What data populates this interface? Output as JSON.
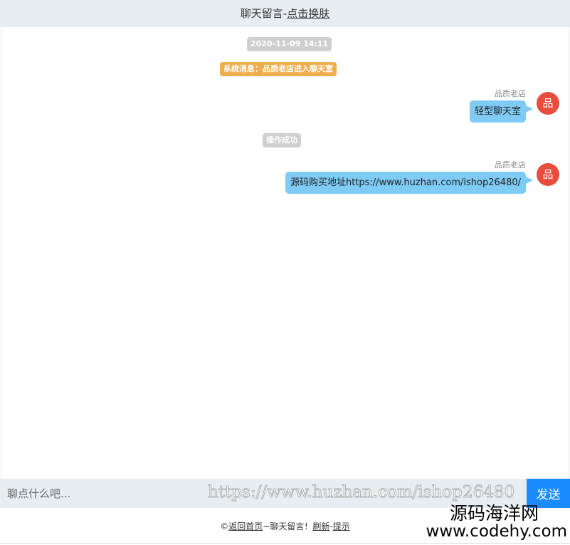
{
  "header": {
    "title": "聊天留言-",
    "skin_link": "点击换肤"
  },
  "messages": {
    "timestamp": "2020-11-09 14:11",
    "system_notice": "系统消息：品质老店进入聊天室",
    "msg1": {
      "sender": "品质老店",
      "text": "轻型聊天室",
      "avatar": "品"
    },
    "status_notice": "操作成功",
    "msg2": {
      "sender": "品质老店",
      "text": "源码购买地址https://www.huzhan.com/ishop26480/",
      "avatar": "品"
    }
  },
  "input_bar": {
    "placeholder": "聊点什么吧...",
    "watermark_url": "https://www.huzhan.com/ishop26480",
    "send_label": "发送"
  },
  "footer": {
    "copyright": "©",
    "home_link": "返回首页",
    "middle_text": "~聊天留言！",
    "refresh_link": "刷新",
    "dash": "-",
    "tips_link": "提示"
  },
  "watermark": {
    "line1": "源码海洋网",
    "line2": "www.codehy.com"
  },
  "colors": {
    "accent": "#1a8cff",
    "bubble": "#7ecbf5",
    "avatar": "#e84c3d",
    "system_notice": "#f0ad4e",
    "muted_pill": "#cfcfcf",
    "bar_bg": "#e8edf1"
  }
}
